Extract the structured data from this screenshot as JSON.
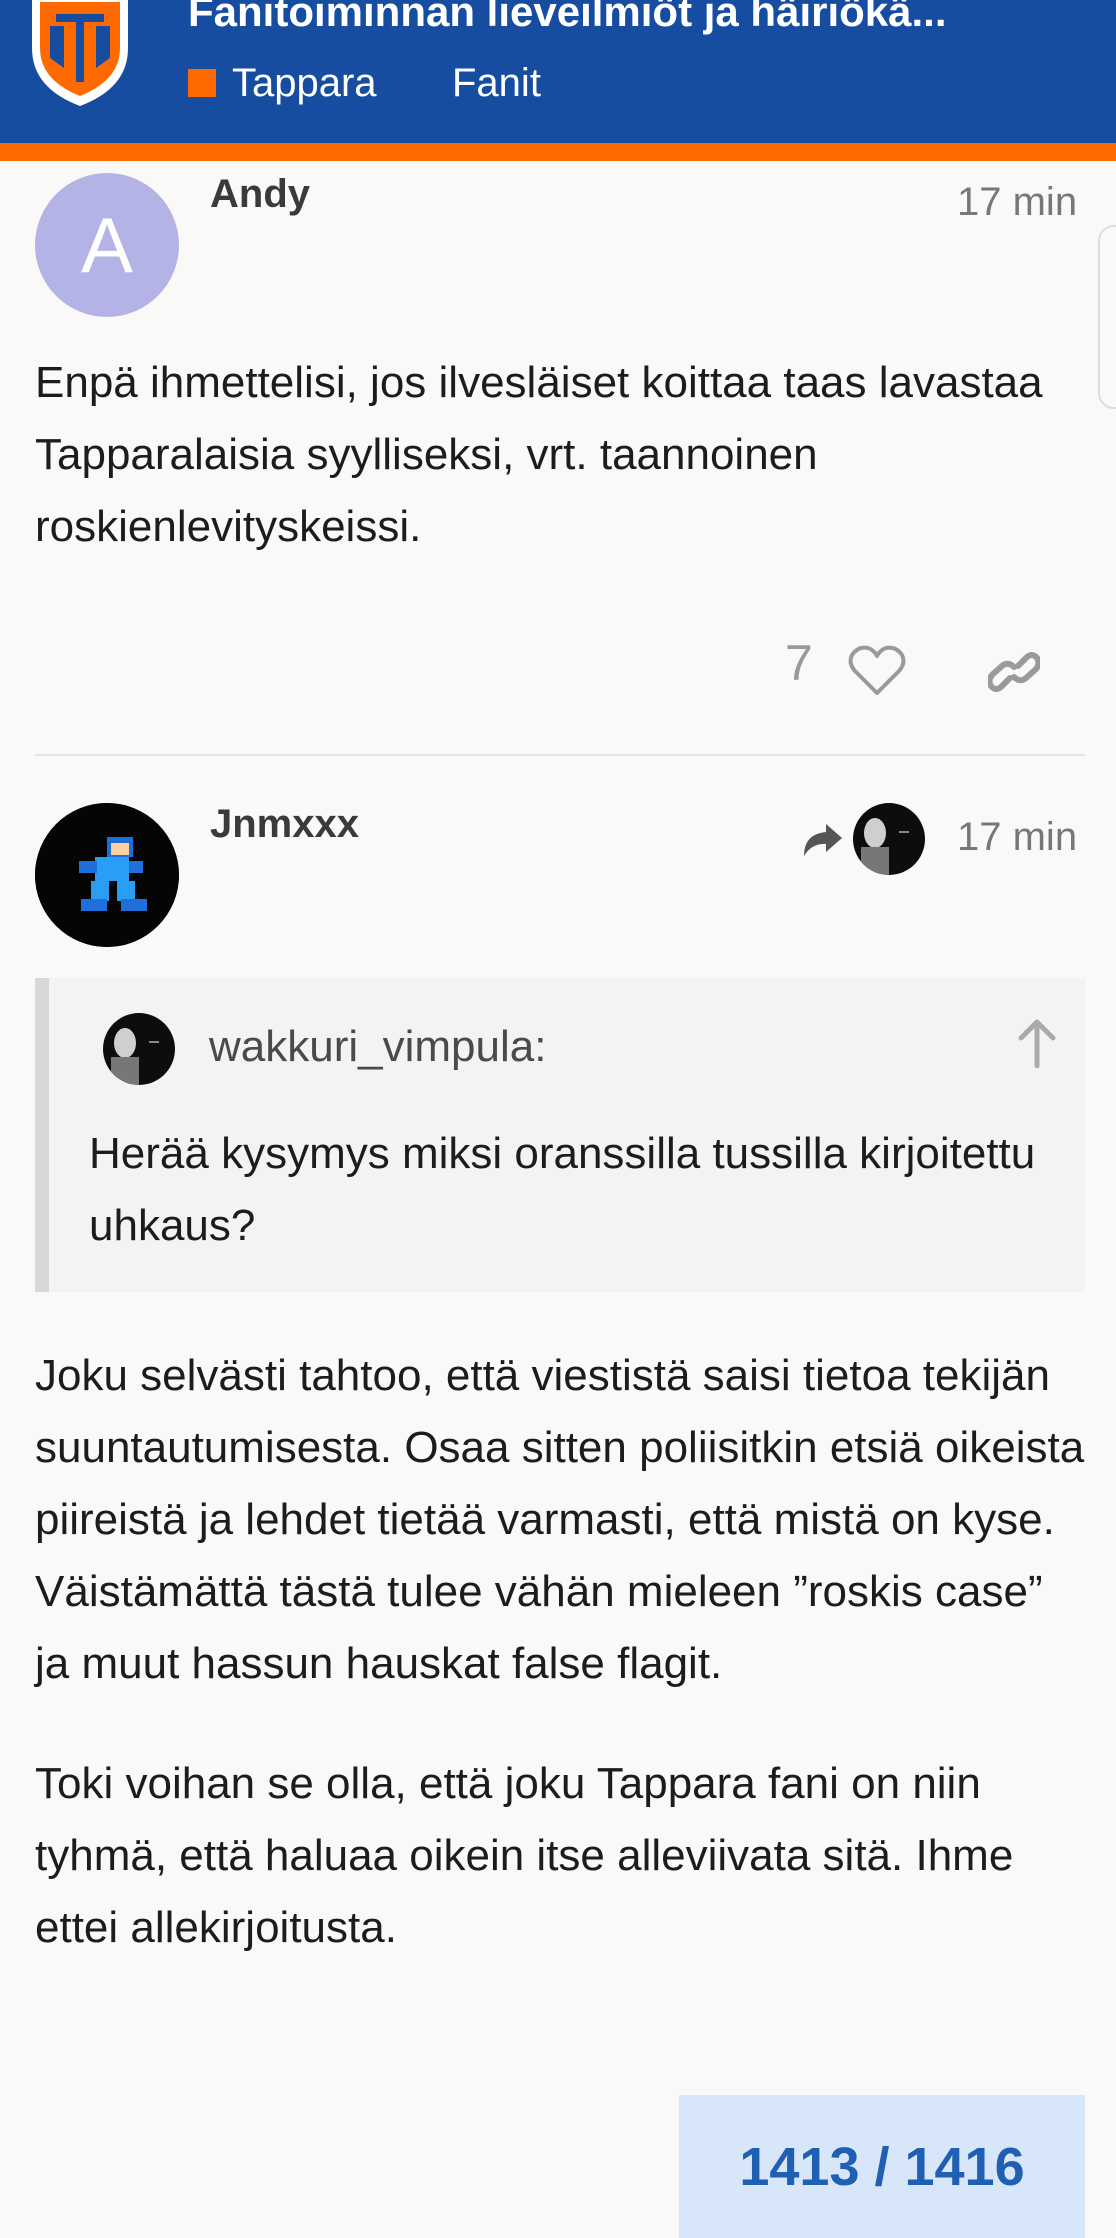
{
  "header": {
    "topic_title": "Fanitoiminnan lieveilmiöt ja häiriökä...",
    "category": "Tappara",
    "tag": "Fanit",
    "brand_color": "#174da1",
    "accent_color": "#ff6a00"
  },
  "posts": [
    {
      "avatar_letter": "A",
      "avatar_color": "#b4b3e6",
      "username": "Andy",
      "time": "17 min",
      "body": [
        "Enpä ihmettelisi, jos ilvesläiset koittaa taas lavastaa Tapparalaisia syylliseksi, vrt. taannoinen roskienlevityskeissi."
      ],
      "likes": "7"
    },
    {
      "username": "Jnmxxx",
      "time": "17 min",
      "quote": {
        "username": "wakkuri_vimpula:",
        "text": "Herää kysymys miksi oranssilla tussilla kirjoitettu uhkaus?"
      },
      "body": [
        "Joku selvästi tahtoo, että viestistä saisi tietoa tekijän suuntautumisesta. Osaa sitten poliisitkin etsiä oikeista piireistä ja lehdet tietää varmasti, että mistä on kyse. Väistämättä tästä tulee vähän mieleen ”roskis case” ja muut hassun hauskat false flagit.",
        "Toki voihan se olla, että joku Tappara fani on niin tyhmä, että haluaa oikein itse alleviivata sitä. Ihme ettei allekirjoitusta."
      ]
    }
  ],
  "progress": "1413 / 1416",
  "icons": [
    "tappara-logo-icon",
    "heart-icon",
    "link-icon",
    "reply-arrow-icon",
    "arrow-up-icon"
  ]
}
